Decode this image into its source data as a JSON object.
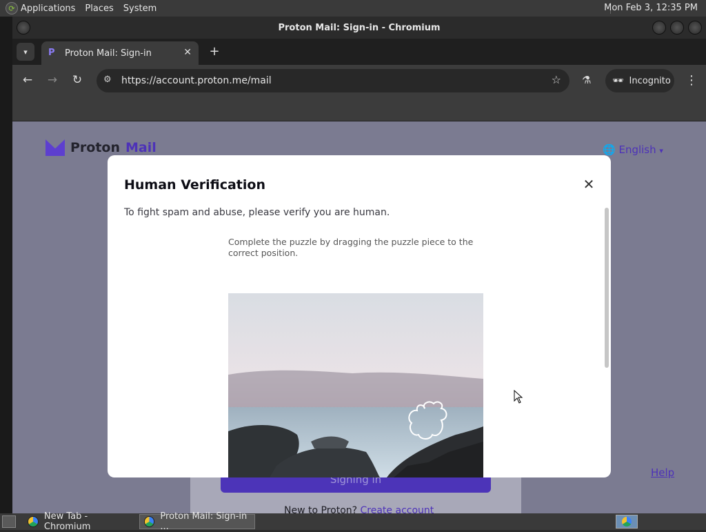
{
  "top_panel": {
    "menus": [
      "Applications",
      "Places",
      "System"
    ],
    "clock": "Mon Feb  3, 12:35 PM"
  },
  "window": {
    "title": "Proton Mail: Sign-in - Chromium"
  },
  "tabs": [
    {
      "label": "Proton Mail: Sign-in",
      "favicon": "P"
    }
  ],
  "toolbar": {
    "url": "https://account.proton.me/mail",
    "incognito_label": "Incognito"
  },
  "page": {
    "brand_proton": "Proton",
    "brand_mail": "Mail",
    "language": "English",
    "help": "Help",
    "signin_button": "Signing in",
    "new_to_proton": "New to Proton?",
    "create_account": "Create account"
  },
  "modal": {
    "title": "Human Verification",
    "description": "To fight spam and abuse, please verify you are human.",
    "puzzle_instruction": "Complete the puzzle by dragging the puzzle piece to the correct position."
  },
  "taskbar": {
    "tasks": [
      {
        "label": "New Tab - Chromium"
      },
      {
        "label": "Proton Mail: Sign-in ..."
      }
    ]
  },
  "colors": {
    "proton_purple": "#4d32b8",
    "chrome_dark": "#3c3c3c",
    "overlay": "#7b7b91"
  }
}
